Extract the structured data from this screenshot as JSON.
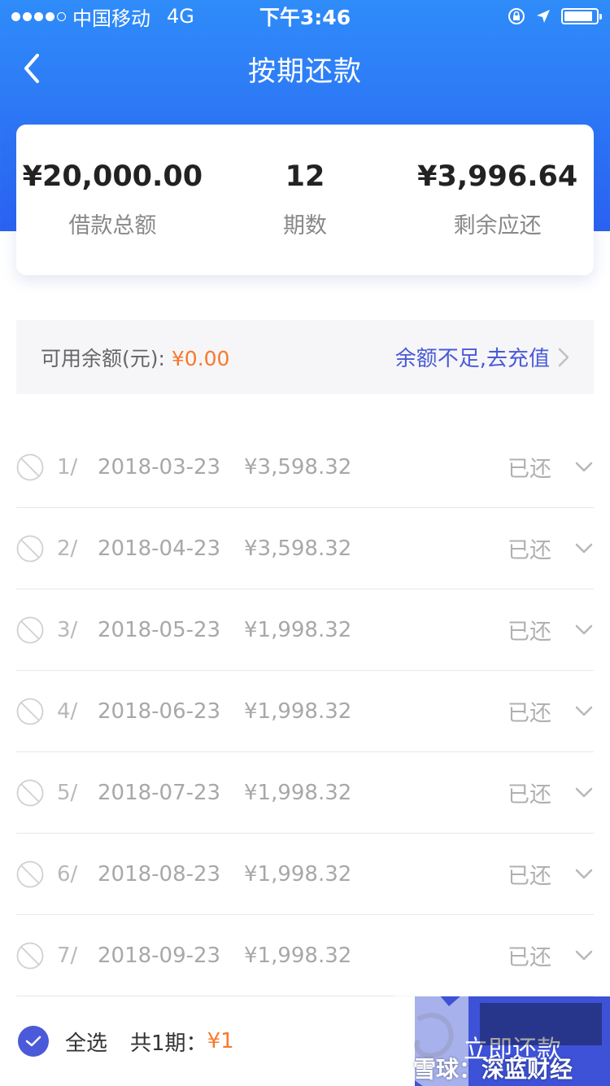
{
  "status_bar": {
    "carrier": "中国移动",
    "network": "4G",
    "time": "下午3:46",
    "signal_bars_filled": 4,
    "signal_bars_total": 5,
    "battery_level": 0.9
  },
  "nav": {
    "title": "按期还款",
    "back_icon": "chevron-left-icon"
  },
  "summary": {
    "loan_total_value": "¥20,000.00",
    "loan_total_label": "借款总额",
    "periods_value": "12",
    "periods_label": "期数",
    "remaining_value": "¥3,996.64",
    "remaining_label": "剩余应还"
  },
  "balance": {
    "label": "可用余额(元): ",
    "amount": "¥0.00",
    "recharge_link": "余额不足,去充值"
  },
  "installments": [
    {
      "index": "1/",
      "date": "2018-03-23",
      "amount": "¥3,598.32",
      "status": "已还"
    },
    {
      "index": "2/",
      "date": "2018-04-23",
      "amount": "¥3,598.32",
      "status": "已还"
    },
    {
      "index": "3/",
      "date": "2018-05-23",
      "amount": "¥1,998.32",
      "status": "已还"
    },
    {
      "index": "4/",
      "date": "2018-06-23",
      "amount": "¥1,998.32",
      "status": "已还"
    },
    {
      "index": "5/",
      "date": "2018-07-23",
      "amount": "¥1,998.32",
      "status": "已还"
    },
    {
      "index": "6/",
      "date": "2018-08-23",
      "amount": "¥1,998.32",
      "status": "已还"
    },
    {
      "index": "7/",
      "date": "2018-09-23",
      "amount": "¥1,998.32",
      "status": "已还"
    }
  ],
  "bottom": {
    "select_all_label": "全选",
    "total_label": "共1期：",
    "total_amount": "¥1",
    "pay_button": "立即还款"
  },
  "watermark": {
    "text": "雪球：深蓝财经"
  },
  "colors": {
    "header_blue": "#2a62f2",
    "accent_orange": "#f7792b",
    "link_blue": "#4a5ad8",
    "button_blue": "#3d52d6"
  }
}
